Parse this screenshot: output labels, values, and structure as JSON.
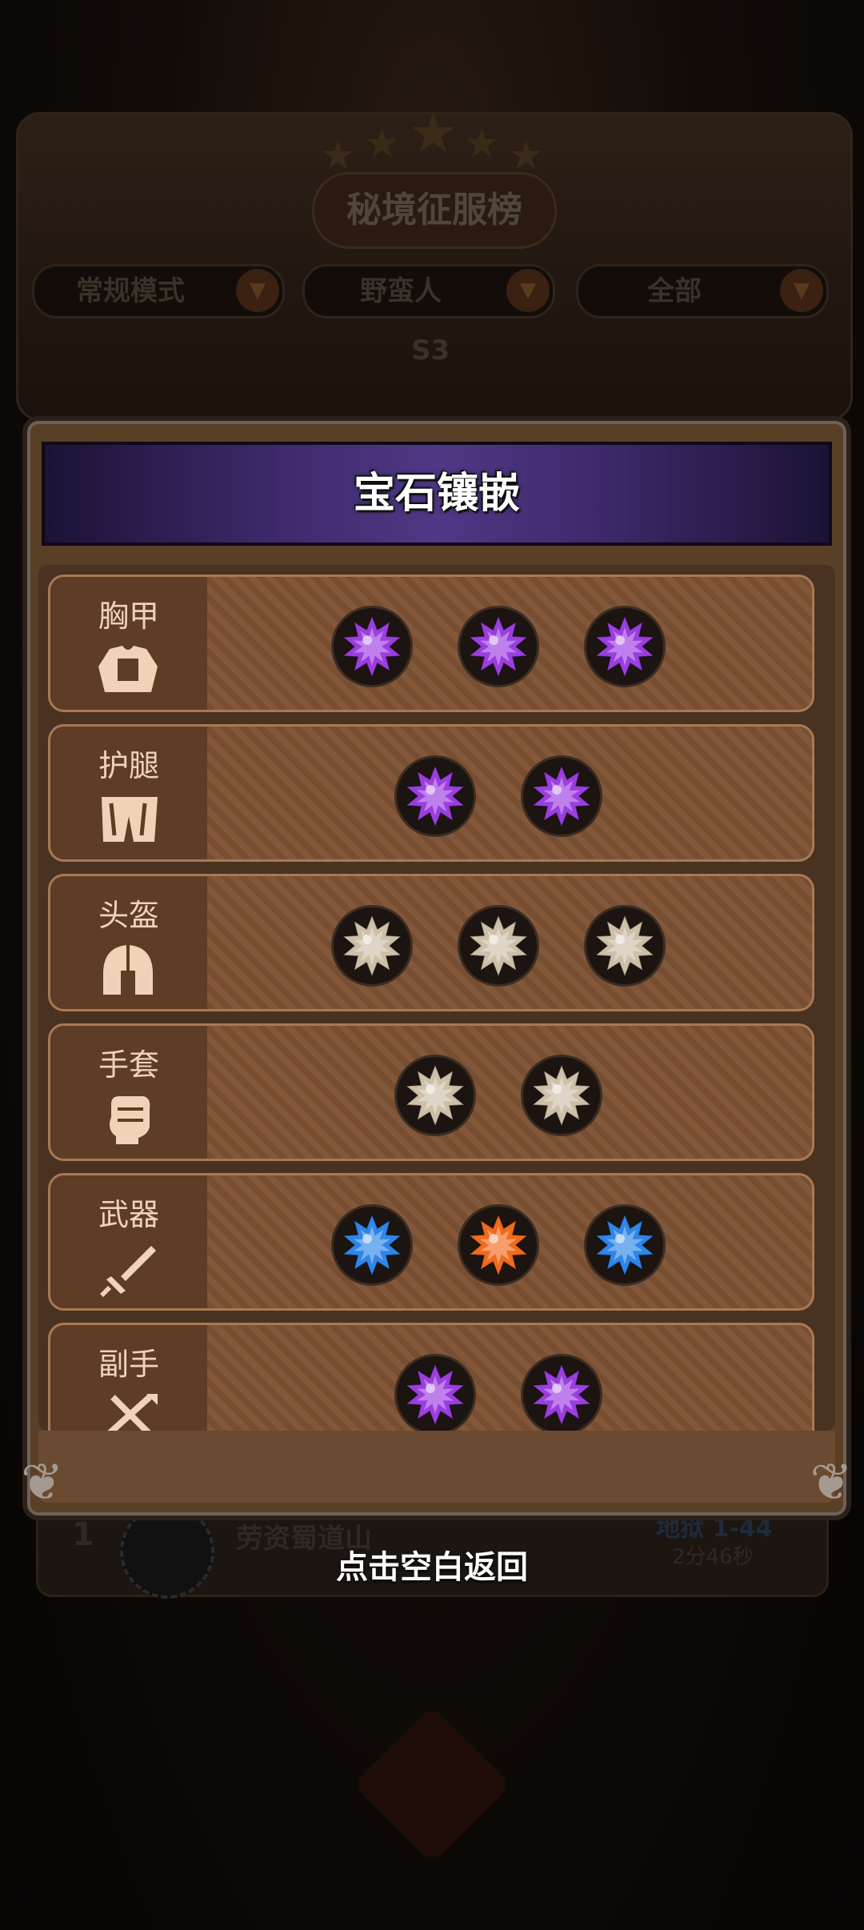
{
  "background": {
    "leaderboard_title": "秘境征服榜",
    "filters": [
      {
        "label": "常规模式"
      },
      {
        "label": "野蛮人"
      },
      {
        "label": "全部"
      }
    ],
    "season": "S3",
    "rank_entry": {
      "rank": "1",
      "name": "劳资蜀道山",
      "level": "地狱 1-44",
      "time": "2分46秒"
    }
  },
  "modal": {
    "title": "宝石镶嵌",
    "rows": [
      {
        "label": "胸甲",
        "icon": "chest-armor-icon",
        "gems": [
          "purple",
          "purple",
          "purple"
        ]
      },
      {
        "label": "护腿",
        "icon": "leg-armor-icon",
        "gems": [
          "purple",
          "purple"
        ]
      },
      {
        "label": "头盔",
        "icon": "helmet-icon",
        "gems": [
          "white",
          "white",
          "white"
        ]
      },
      {
        "label": "手套",
        "icon": "glove-icon",
        "gems": [
          "white",
          "white"
        ]
      },
      {
        "label": "武器",
        "icon": "weapon-icon",
        "gems": [
          "blue",
          "orange",
          "blue"
        ]
      },
      {
        "label": "副手",
        "icon": "offhand-icon",
        "gems": [
          "purple",
          "purple"
        ]
      }
    ]
  },
  "gem_colors": {
    "purple": "#9b3ee0",
    "white": "#cdbfa8",
    "blue": "#2f86e8",
    "orange": "#f06a1e"
  },
  "hint": "点击空白返回"
}
